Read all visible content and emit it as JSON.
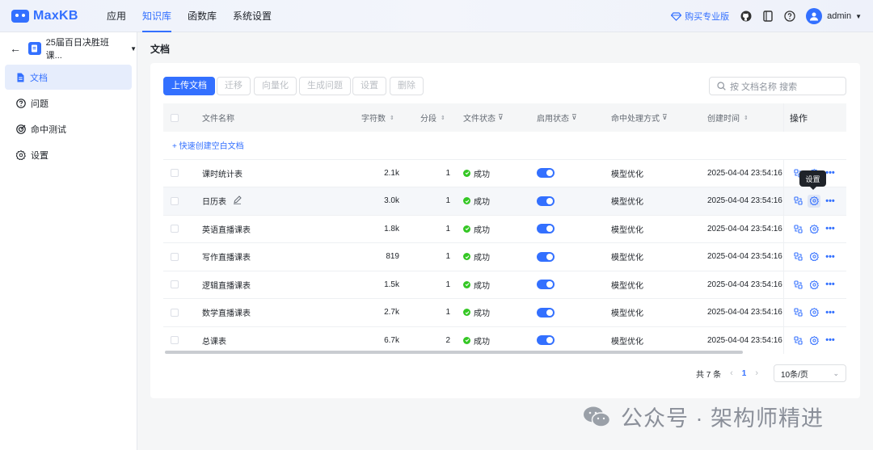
{
  "app": {
    "logo_text": "MaxKB"
  },
  "nav": [
    {
      "label": "应用"
    },
    {
      "label": "知识库"
    },
    {
      "label": "函数库"
    },
    {
      "label": "系统设置"
    }
  ],
  "top_right": {
    "buy_label": "购买专业版",
    "username": "admin"
  },
  "sidebar": {
    "kb_name": "25届百日决胜班课...",
    "items": [
      {
        "label": "文档"
      },
      {
        "label": "问题"
      },
      {
        "label": "命中测试"
      },
      {
        "label": "设置"
      }
    ]
  },
  "main": {
    "title": "文档"
  },
  "toolbar": {
    "upload": "上传文档",
    "migrate": "迁移",
    "vectorize": "向量化",
    "gen_questions": "生成问题",
    "settings": "设置",
    "delete": "删除",
    "search_placeholder": "按 文档名称 搜索"
  },
  "table": {
    "columns": {
      "name": "文件名称",
      "chars": "字符数",
      "segments": "分段",
      "file_status": "文件状态",
      "enable_status": "启用状态",
      "hit_method": "命中处理方式",
      "created": "创建时间",
      "ops": "操作"
    },
    "quick_create": "+ 快速创建空白文档",
    "rows": [
      {
        "name": "课时统计表",
        "chars": "2.1k",
        "segments": "1",
        "status": "成功",
        "method": "模型优化",
        "created": "2025-04-04 23:54:16"
      },
      {
        "name": "日历表",
        "chars": "3.0k",
        "segments": "1",
        "status": "成功",
        "method": "模型优化",
        "created": "2025-04-04 23:54:16"
      },
      {
        "name": "英语直播课表",
        "chars": "1.8k",
        "segments": "1",
        "status": "成功",
        "method": "模型优化",
        "created": "2025-04-04 23:54:16"
      },
      {
        "name": "写作直播课表",
        "chars": "819",
        "segments": "1",
        "status": "成功",
        "method": "模型优化",
        "created": "2025-04-04 23:54:16"
      },
      {
        "name": "逻辑直播课表",
        "chars": "1.5k",
        "segments": "1",
        "status": "成功",
        "method": "模型优化",
        "created": "2025-04-04 23:54:16"
      },
      {
        "name": "数学直播课表",
        "chars": "2.7k",
        "segments": "1",
        "status": "成功",
        "method": "模型优化",
        "created": "2025-04-04 23:54:16"
      },
      {
        "name": "总课表",
        "chars": "6.7k",
        "segments": "2",
        "status": "成功",
        "method": "模型优化",
        "created": "2025-04-04 23:54:16"
      }
    ]
  },
  "tooltip": "设置",
  "pagination": {
    "total": "共 7 条",
    "current": "1",
    "page_size": "10条/页"
  },
  "watermark": "公众号 · 架构师精进",
  "colors": {
    "accent": "#3370ff",
    "success": "#34c724"
  }
}
